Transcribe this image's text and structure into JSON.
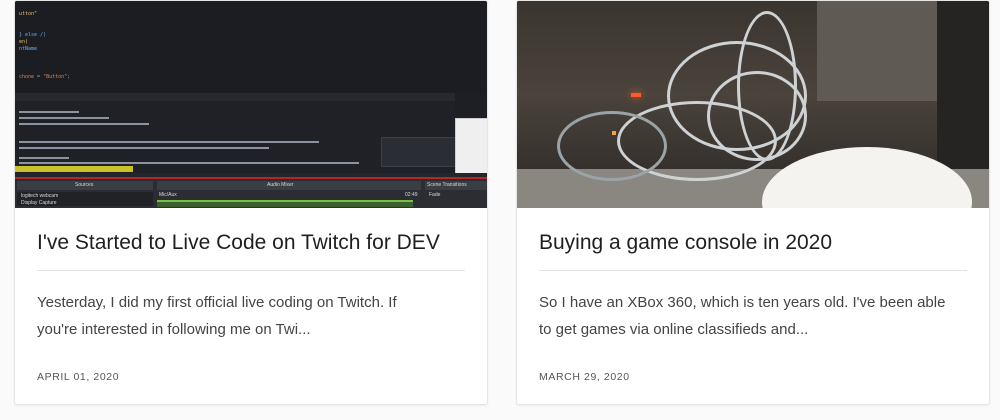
{
  "posts": [
    {
      "title": "I've Started to Live Code on Twitch for DEV",
      "excerpt_line1": "Yesterday, I did my first official live coding on Twitch. If",
      "excerpt_line2": "you're interested in following me on Twi...",
      "date": "APRIL 01, 2020",
      "thumbnail": {
        "code_lines": [
          "utton\"",
          "",
          "",
          "} else /)",
          "en)",
          "ntName",
          "",
          "",
          "",
          "chone = \"Button\";"
        ],
        "obs_labels": [
          "Sources",
          "Audio Mixer",
          "Scene Transitions"
        ],
        "source_items": [
          "logitech webcam",
          "Display Capture"
        ],
        "mixer_item": "Mic/Aux",
        "mixer_value": "02:49",
        "transition": "Fade"
      }
    },
    {
      "title": "Buying a game console in 2020",
      "excerpt_line1": "So I have an XBox 360, which is ten years old. I've been able",
      "excerpt_line2": "to get games via online classifieds and...",
      "date": "MARCH 29, 2020"
    }
  ],
  "colors": {
    "card_bg": "#ffffff",
    "page_bg": "#fafafa",
    "title": "#1f1f1f",
    "text": "#444444"
  }
}
